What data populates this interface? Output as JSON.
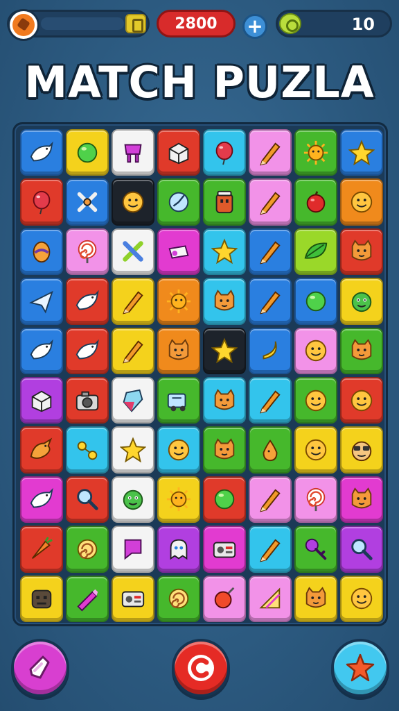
{
  "header": {
    "coins": "2800",
    "plus_label": "+",
    "moves": "10"
  },
  "title": "MATCH PUZLA",
  "colors": {
    "blue": "#2a7fe0",
    "yellow": "#f4d21c",
    "white": "#f4f4f4",
    "red": "#e03a2a",
    "cyan": "#33c4ec",
    "pink": "#f292e8",
    "green": "#46b82c",
    "orange": "#f08a1c",
    "black": "#1d232b",
    "purple": "#b13fe0",
    "lime": "#9ad829",
    "magenta": "#e23bd0"
  },
  "board": {
    "rows": [
      [
        [
          "blue",
          "bird-icon"
        ],
        [
          "yellow",
          "ball-icon"
        ],
        [
          "white",
          "cup-icon"
        ],
        [
          "red",
          "box-icon"
        ],
        [
          "cyan",
          "balloon-icon"
        ],
        [
          "pink",
          "pencil-icon"
        ],
        [
          "green",
          "sun-icon"
        ],
        [
          "blue",
          "star-icon"
        ]
      ],
      [
        [
          "red",
          "balloon-icon"
        ],
        [
          "blue",
          "cross-icon"
        ],
        [
          "black",
          "face-icon"
        ],
        [
          "green",
          "clock-icon"
        ],
        [
          "green",
          "jar-icon"
        ],
        [
          "pink",
          "pencil-icon"
        ],
        [
          "green",
          "apple-icon"
        ],
        [
          "orange",
          "face-icon"
        ]
      ],
      [
        [
          "blue",
          "egg-icon"
        ],
        [
          "pink",
          "lollipop-icon"
        ],
        [
          "white",
          "tools-icon"
        ],
        [
          "magenta",
          "whistle-icon"
        ],
        [
          "cyan",
          "star-icon"
        ],
        [
          "blue",
          "pencil-icon"
        ],
        [
          "lime",
          "leaf-icon"
        ],
        [
          "red",
          "cat-icon"
        ]
      ],
      [
        [
          "blue",
          "plane-icon"
        ],
        [
          "red",
          "bird-icon"
        ],
        [
          "yellow",
          "pencil-icon"
        ],
        [
          "orange",
          "sun-icon"
        ],
        [
          "cyan",
          "cat-icon"
        ],
        [
          "blue",
          "pencil-icon"
        ],
        [
          "blue",
          "ball-icon"
        ],
        [
          "yellow",
          "monster-icon"
        ]
      ],
      [
        [
          "blue",
          "bird-icon"
        ],
        [
          "red",
          "bird-icon"
        ],
        [
          "yellow",
          "pencil-icon"
        ],
        [
          "orange",
          "cat-icon"
        ],
        [
          "black",
          "star-icon"
        ],
        [
          "blue",
          "banana-icon"
        ],
        [
          "pink",
          "face-icon"
        ],
        [
          "green",
          "cat-icon"
        ]
      ],
      [
        [
          "purple",
          "box-icon"
        ],
        [
          "red",
          "camera-icon"
        ],
        [
          "white",
          "gem-icon"
        ],
        [
          "green",
          "truck-icon"
        ],
        [
          "cyan",
          "cat-icon"
        ],
        [
          "cyan",
          "pencil-icon"
        ],
        [
          "green",
          "face-icon"
        ],
        [
          "red",
          "face-icon"
        ]
      ],
      [
        [
          "red",
          "dragon-icon"
        ],
        [
          "cyan",
          "dots-icon"
        ],
        [
          "white",
          "star-icon"
        ],
        [
          "cyan",
          "face-icon"
        ],
        [
          "green",
          "cat-icon"
        ],
        [
          "green",
          "pear-icon"
        ],
        [
          "yellow",
          "face-icon"
        ],
        [
          "yellow",
          "glasses-icon"
        ]
      ],
      [
        [
          "magenta",
          "bird-icon"
        ],
        [
          "red",
          "magnifier-icon"
        ],
        [
          "white",
          "monster-icon"
        ],
        [
          "yellow",
          "sun-icon"
        ],
        [
          "red",
          "ball-icon"
        ],
        [
          "pink",
          "pencil-icon"
        ],
        [
          "pink",
          "lollipop-icon"
        ],
        [
          "magenta",
          "cat-icon"
        ]
      ],
      [
        [
          "red",
          "carrot-icon"
        ],
        [
          "green",
          "spiral-icon"
        ],
        [
          "white",
          "flag-icon"
        ],
        [
          "purple",
          "ghost-icon"
        ],
        [
          "magenta",
          "radio-icon"
        ],
        [
          "cyan",
          "pencil-icon"
        ],
        [
          "green",
          "key-icon"
        ],
        [
          "purple",
          "magnifier-icon"
        ]
      ],
      [
        [
          "yellow",
          "robot-icon"
        ],
        [
          "green",
          "crayon-icon"
        ],
        [
          "yellow",
          "radio-icon"
        ],
        [
          "green",
          "spiral-icon"
        ],
        [
          "pink",
          "fruit-icon"
        ],
        [
          "pink",
          "ruler-icon"
        ],
        [
          "yellow",
          "cat-icon"
        ],
        [
          "yellow",
          "face-icon"
        ]
      ]
    ]
  },
  "buttons": {
    "hint": "hint-icon",
    "restart": "restart-icon",
    "star": "star-icon"
  }
}
